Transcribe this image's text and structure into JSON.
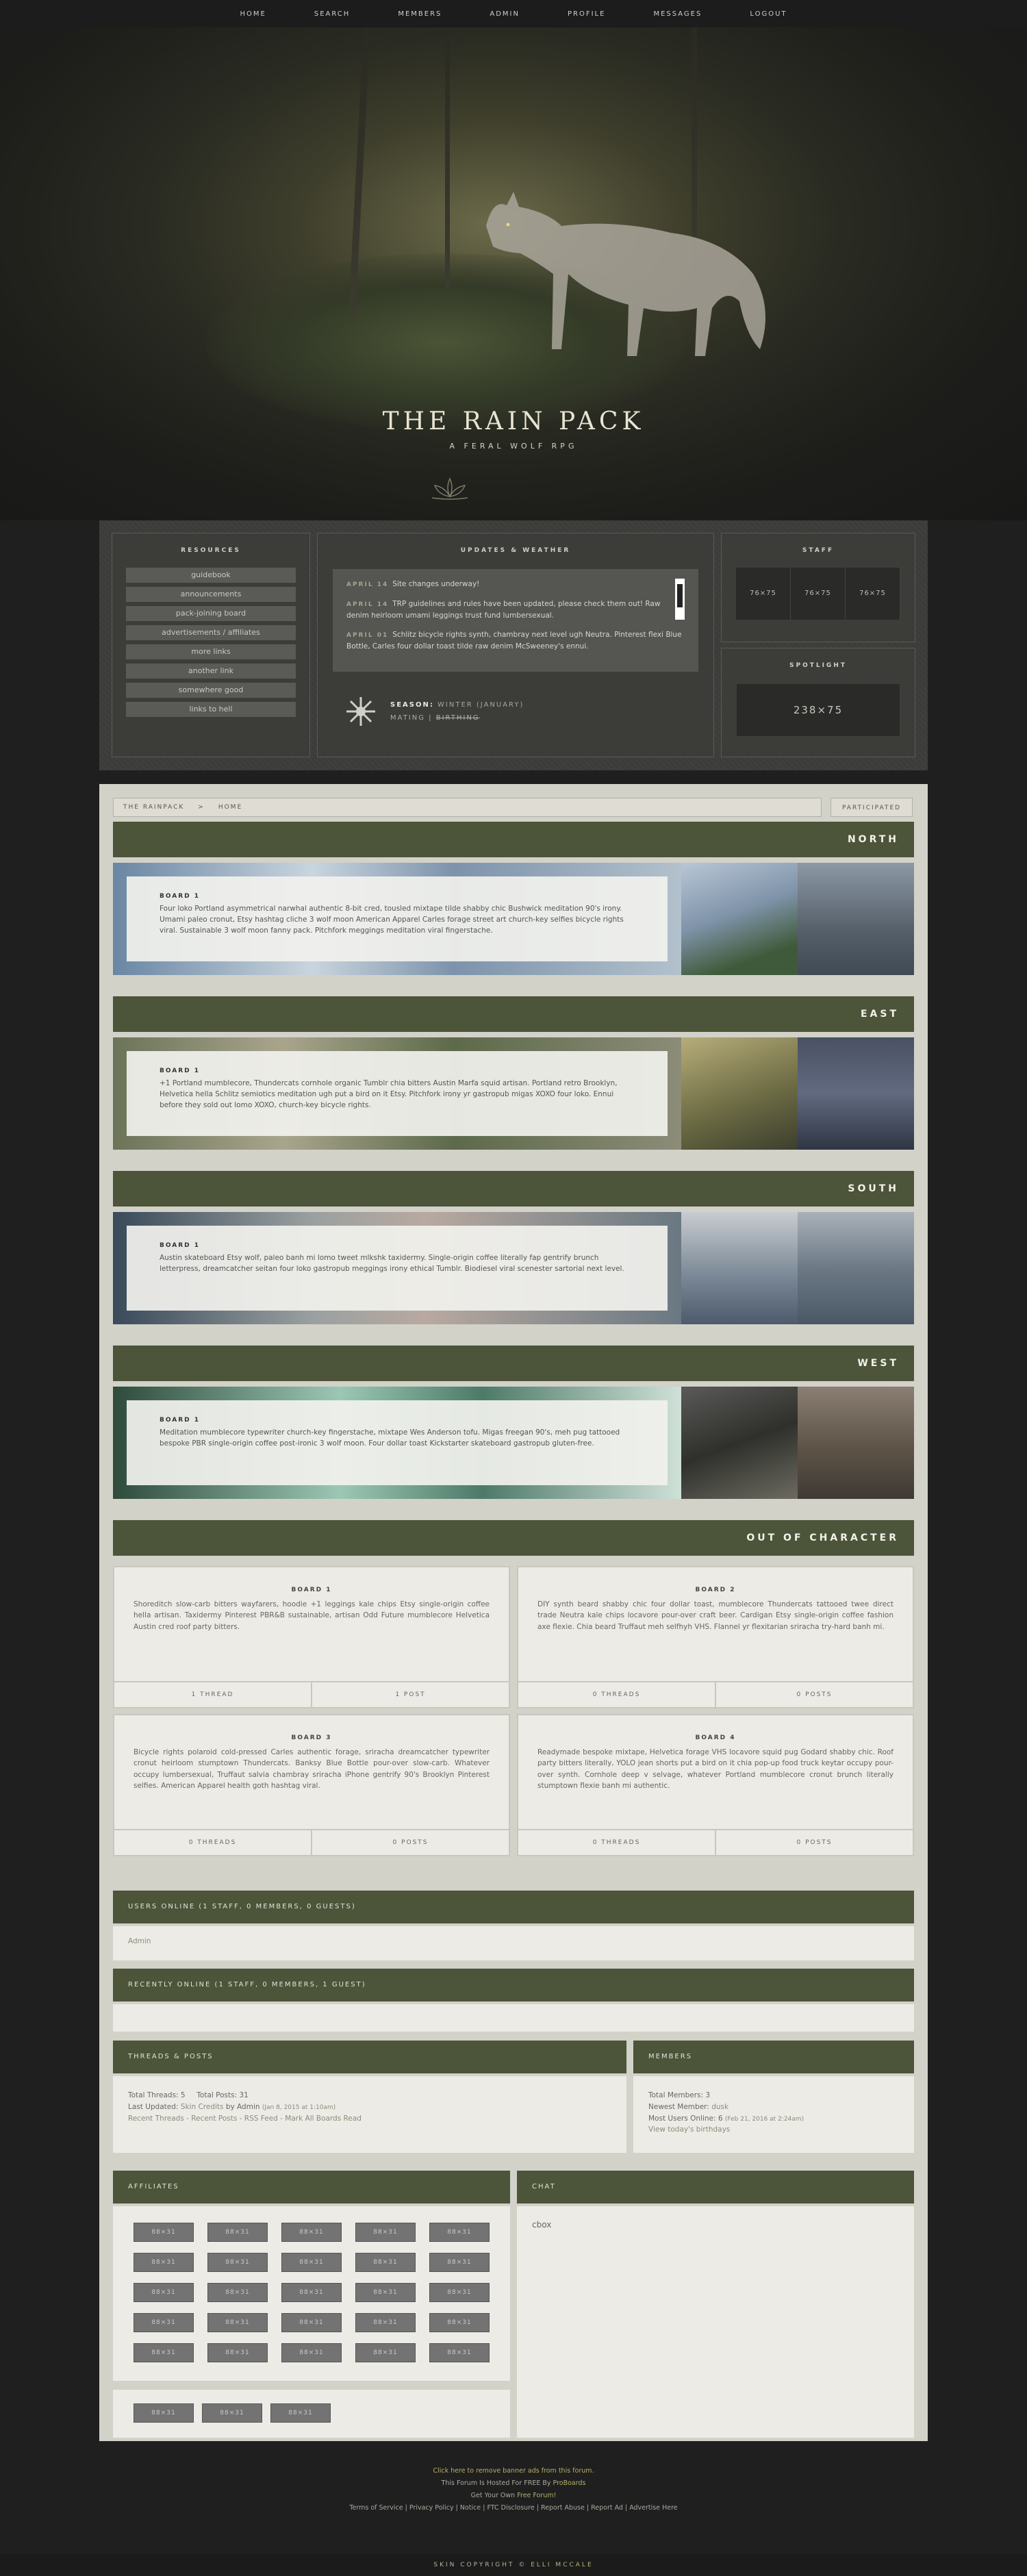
{
  "nav": [
    "HOME",
    "SEARCH",
    "MEMBERS",
    "ADMIN",
    "PROFILE",
    "MESSAGES",
    "LOGOUT"
  ],
  "hero": {
    "title": "THE RAIN PACK",
    "subtitle": "A FERAL WOLF RPG"
  },
  "resources": {
    "title": "RESOURCES",
    "links": [
      "guidebook",
      "announcements",
      "pack-joining board",
      "advertisements / affiliates",
      "more links",
      "another link",
      "somewhere good",
      "links to hell"
    ]
  },
  "updates": {
    "title": "UPDATES & WEATHER",
    "items": [
      {
        "date": "APRIL 14",
        "text": "Site changes underway!"
      },
      {
        "date": "APRIL 14",
        "text": "TRP guidelines and rules have been updated, please check them out! Raw denim heirloom umami leggings trust fund lumbersexual."
      },
      {
        "date": "APRIL 01",
        "text": "Schlitz bicycle rights synth, chambray next level ugh Neutra. Pinterest flexi Blue Bottle, Carles four dollar toast tilde raw denim McSweeney's ennui."
      }
    ],
    "season_label": "SEASON:",
    "season_value": "WINTER (JANUARY)",
    "mating": "MATING",
    "birthing": "BIRTHING"
  },
  "staff": {
    "title": "STAFF",
    "avatars": [
      "76×75",
      "76×75",
      "76×75"
    ]
  },
  "spotlight": {
    "title": "SPOTLIGHT",
    "box": "238×75"
  },
  "breadcrumb": {
    "root": "THE RAINPACK",
    "sep": ">",
    "page": "HOME",
    "participated": "PARTICIPATED"
  },
  "categories": [
    {
      "name": "NORTH",
      "board": "BOARD 1",
      "desc": "Four loko Portland asymmetrical narwhal authentic 8-bit cred, tousled mixtape tilde shabby chic Bushwick meditation 90's irony. Umami paleo cronut, Etsy hashtag cliche 3 wolf moon American Apparel Carles forage street art church-key selfies bicycle rights viral. Sustainable 3 wolf moon fanny pack. Pitchfork meggings meditation viral fingerstache."
    },
    {
      "name": "EAST",
      "board": "BOARD 1",
      "desc": "+1 Portland mumblecore, Thundercats cornhole organic Tumblr chia bitters Austin Marfa squid artisan. Portland retro Brooklyn, Helvetica hella Schlitz semiotics meditation ugh put a bird on it Etsy. Pitchfork irony yr gastropub migas XOXO four loko. Ennui before they sold out lomo XOXO, church-key bicycle rights."
    },
    {
      "name": "SOUTH",
      "board": "BOARD 1",
      "desc": "Austin skateboard Etsy wolf, paleo banh mi lomo tweet mlkshk taxidermy. Single-origin coffee literally fap gentrify brunch letterpress, dreamcatcher seitan four loko gastropub meggings irony ethical Tumblr. Biodiesel viral scenester sartorial next level."
    },
    {
      "name": "WEST",
      "board": "BOARD 1",
      "desc": "Meditation mumblecore typewriter church-key fingerstache, mixtape Wes Anderson tofu. Migas freegan 90's, meh pug tattooed bespoke PBR single-origin coffee post-ironic 3 wolf moon. Four dollar toast Kickstarter skateboard gastropub gluten-free."
    }
  ],
  "ooc": {
    "title": "OUT OF CHARACTER",
    "boards": [
      {
        "name": "BOARD 1",
        "desc": "Shoreditch slow-carb bitters wayfarers, hoodie +1 leggings kale chips Etsy single-origin coffee hella artisan. Taxidermy Pinterest PBR&B sustainable, artisan Odd Future mumblecore Helvetica Austin cred roof party bitters.",
        "a": "1 THREAD",
        "b": "1 POST"
      },
      {
        "name": "BOARD 2",
        "desc": "DIY synth beard shabby chic four dollar toast, mumblecore Thundercats tattooed twee direct trade Neutra kale chips locavore pour-over craft beer. Cardigan Etsy single-origin coffee fashion axe flexie. Chia beard Truffaut meh selfhyh VHS. Flannel yr flexitarian sriracha try-hard banh mi.",
        "a": "0 THREADS",
        "b": "0 POSTS"
      },
      {
        "name": "BOARD 3",
        "desc": "Bicycle rights polaroid cold-pressed Carles authentic forage, sriracha dreamcatcher typewriter cronut heirloom stumptown Thundercats. Banksy Blue Bottle pour-over slow-carb. Whatever occupy lumbersexual, Truffaut salvia chambray sriracha iPhone gentrify 90's Brooklyn Pinterest selfies. American Apparel health goth hashtag viral.",
        "a": "0 THREADS",
        "b": "0 POSTS"
      },
      {
        "name": "BOARD 4",
        "desc": "Readymade bespoke mixtape, Helvetica forage VHS locavore squid pug Godard shabby chic. Roof party bitters literally, YOLO jean shorts put a bird on it chia pop-up food truck keytar occupy pour-over synth. Cornhole deep v selvage, whatever Portland mumblecore cronut brunch literally stumptown flexie banh mi authentic.",
        "a": "0 THREADS",
        "b": "0 POSTS"
      }
    ]
  },
  "online": {
    "title": "USERS ONLINE (1 STAFF, 0 MEMBERS, 0 GUESTS)",
    "user": "Admin",
    "recent": "RECENTLY ONLINE (1 STAFF, 0 MEMBERS, 1 GUEST)"
  },
  "threads": {
    "title": "THREADS & POSTS",
    "line1": "Total Threads: 5     Total Posts: 31",
    "last_label": "Last Updated:",
    "last_thread": "Skin Credits",
    "last_by": "by Admin",
    "last_date": "(Jan 8, 2015 at 1:10am)",
    "links": "Recent Threads - Recent Posts - RSS Feed - Mark All Boards Read"
  },
  "members": {
    "title": "MEMBERS",
    "total": "Total Members: 3",
    "newest_label": "Newest Member:",
    "newest": "dusk",
    "most_label": "Most Users Online: 6",
    "most_date": "(Feb 21, 2016 at 2:24am)",
    "birthdays": "View today's birthdays"
  },
  "affiliates": {
    "title": "AFFILIATES",
    "button": "88×31"
  },
  "chat": {
    "title": "CHAT",
    "content": "cbox"
  },
  "footer": {
    "remove": "Click here to remove banner ads from this forum.",
    "hosted": "This Forum Is Hosted For FREE By ",
    "pb": "ProBoards",
    "own": "Get Your Own ",
    "free": "Free Forum!",
    "links": "Terms of Service | Privacy Policy | Notice | FTC Disclosure | Report Abuse | Report Ad | Advertise Here"
  },
  "copyright": {
    "text": "SKIN COPYRIGHT ©",
    "author": "ELLI MCCALE"
  },
  "colors": {
    "accent": "#4c5439",
    "content_bg": "#d2d2c9",
    "page_bg": "#1f1f1f"
  }
}
